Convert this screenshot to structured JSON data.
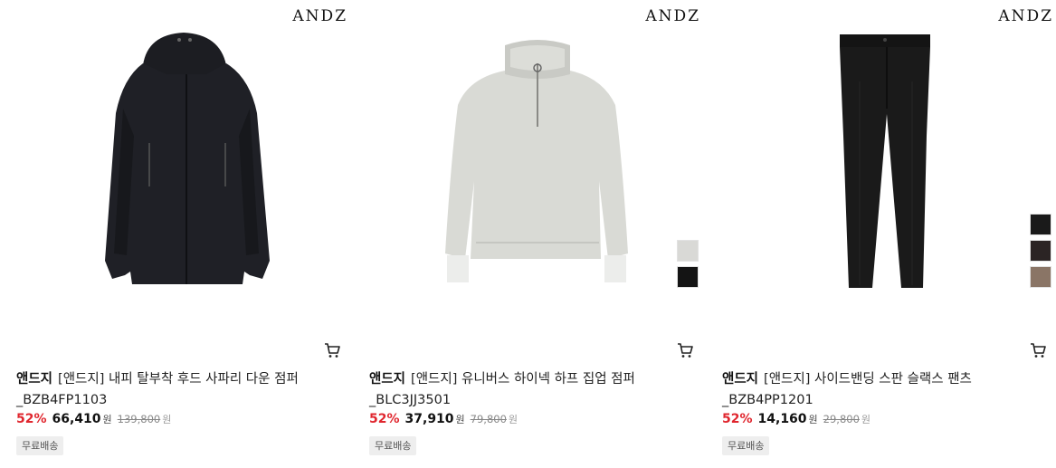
{
  "products": [
    {
      "logo": "ANDZ",
      "brand": "앤드지",
      "name": "[앤드지] 내피 탈부착 후드 사파리 다운 점퍼",
      "code": "_BZB4FP1103",
      "discount": "52%",
      "price": "66,410",
      "currency": "원",
      "original_price": "139,800",
      "original_currency": "원",
      "badge": "무료배송",
      "swatches": []
    },
    {
      "logo": "ANDZ",
      "brand": "앤드지",
      "name": "[앤드지] 유니버스 하이넥 하프 집업 점퍼",
      "code": "_BLC3JJ3501",
      "discount": "52%",
      "price": "37,910",
      "currency": "원",
      "original_price": "79,800",
      "original_currency": "원",
      "badge": "무료배송",
      "swatches": [
        "#d9d9d6",
        "#141414"
      ]
    },
    {
      "logo": "ANDZ",
      "brand": "앤드지",
      "name": "[앤드지] 사이드밴딩 스판 슬랙스 팬츠",
      "code": "_BZB4PP1201",
      "discount": "52%",
      "price": "14,160",
      "currency": "원",
      "original_price": "29,800",
      "original_currency": "원",
      "badge": "무료배송",
      "swatches": [
        "#1a1a1a",
        "#2b2424",
        "#8a7566"
      ]
    }
  ],
  "icons": {
    "cart": "cart-icon"
  }
}
